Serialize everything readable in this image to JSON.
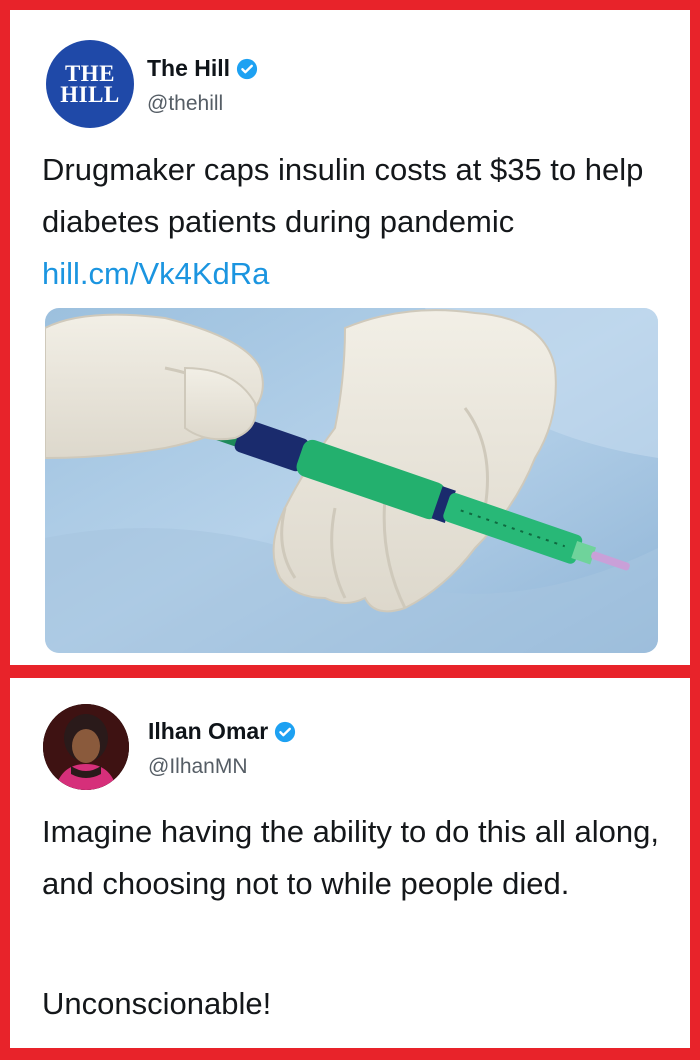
{
  "tweet1": {
    "avatar_text": [
      "THE",
      "HILL"
    ],
    "display_name": "The Hill",
    "handle": "@thehill",
    "text": "Drugmaker caps insulin costs at $35 to help diabetes patients during pandemic",
    "link": "hill.cm/Vk4KdRa"
  },
  "tweet2": {
    "display_name": "Ilhan Omar",
    "handle": "@IlhanMN",
    "text": "Imagine having the ability to do this all along, and choosing not to while people died.",
    "text2": "Unconscionable!"
  },
  "colors": {
    "frame": "#e8232a",
    "hill_blue": "#1f49a8",
    "link_blue": "#1b95e0",
    "verified_blue": "#1da1f2"
  }
}
